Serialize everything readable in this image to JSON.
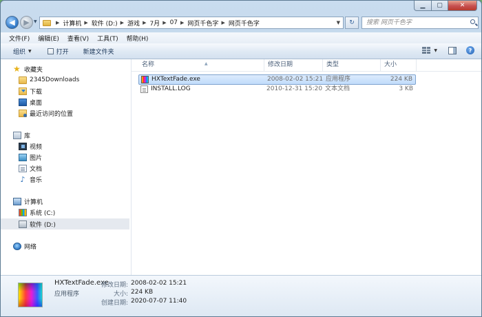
{
  "window": {
    "caption_min": "▁",
    "caption_max": "▢",
    "caption_close": "✕"
  },
  "address": {
    "breadcrumbs": [
      "计算机",
      "软件 (D:)",
      "游戏",
      "7月",
      "07",
      "网页千色字",
      "网页千色字"
    ],
    "search_placeholder": "搜索 网页千色字"
  },
  "menu": [
    "文件(F)",
    "编辑(E)",
    "查看(V)",
    "工具(T)",
    "帮助(H)"
  ],
  "toolbar": {
    "organize": "组织",
    "open": "打开",
    "new_folder": "新建文件夹"
  },
  "nav": {
    "favorites": "收藏夹",
    "fav_items": [
      "2345Downloads",
      "下载",
      "桌面",
      "最近访问的位置"
    ],
    "libraries": "库",
    "lib_items": [
      "视频",
      "图片",
      "文档",
      "音乐"
    ],
    "computer": "计算机",
    "drives": [
      "系统 (C:)",
      "软件 (D:)"
    ],
    "network": "网络"
  },
  "columns": {
    "name": "名称",
    "date": "修改日期",
    "type": "类型",
    "size": "大小"
  },
  "files": [
    {
      "name": "HXTextFade.exe",
      "date": "2008-02-02 15:21",
      "type": "应用程序",
      "size": "224 KB",
      "selected": true
    },
    {
      "name": "INSTALL.LOG",
      "date": "2010-12-31 15:20",
      "type": "文本文档",
      "size": "3 KB",
      "selected": false
    }
  ],
  "details": {
    "name": "HXTextFade.exe",
    "type": "应用程序",
    "modified_label": "修改日期:",
    "modified_value": "2008-02-02 15:21",
    "size_label": "大小:",
    "size_value": "224 KB",
    "created_label": "创建日期:",
    "created_value": "2020-07-07 11:40"
  },
  "colors": {
    "selection": "#c1dcfb",
    "selection_border": "#7da2ce",
    "window_frame": "#b7cde4"
  }
}
